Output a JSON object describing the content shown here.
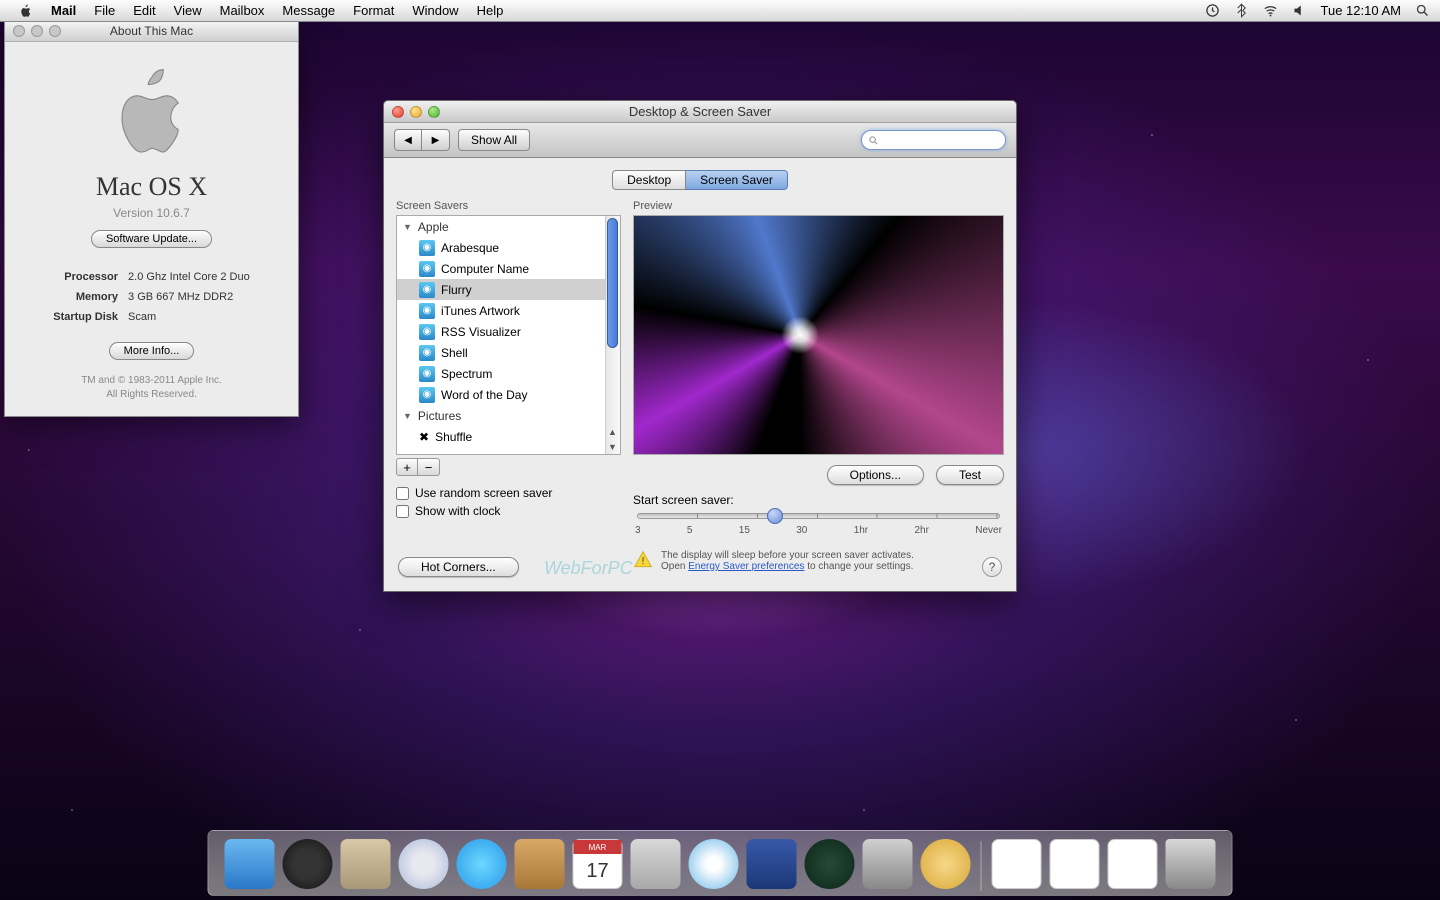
{
  "menubar": {
    "app": "Mail",
    "items": [
      "File",
      "Edit",
      "View",
      "Mailbox",
      "Message",
      "Format",
      "Window",
      "Help"
    ],
    "clock": "Tue 12:10 AM"
  },
  "about": {
    "title": "About This Mac",
    "os_name": "Mac OS X",
    "version": "Version 10.6.7",
    "software_update": "Software Update...",
    "specs": {
      "processor_label": "Processor",
      "processor_value": "2.0 Ghz Intel Core 2 Duo",
      "memory_label": "Memory",
      "memory_value": "3 GB 667 MHz DDR2",
      "disk_label": "Startup Disk",
      "disk_value": "Scam"
    },
    "more_info": "More Info...",
    "copyright1": "TM and © 1983-2011 Apple Inc.",
    "copyright2": "All Rights Reserved."
  },
  "prefs": {
    "title": "Desktop & Screen Saver",
    "show_all": "Show All",
    "tabs": {
      "desktop": "Desktop",
      "screensaver": "Screen Saver"
    },
    "left_label": "Screen Savers",
    "right_label": "Preview",
    "groups": {
      "apple": "Apple",
      "pictures": "Pictures"
    },
    "savers": [
      "Arabesque",
      "Computer Name",
      "Flurry",
      "iTunes Artwork",
      "RSS Visualizer",
      "Shell",
      "Spectrum",
      "Word of the Day"
    ],
    "shuffle": "Shuffle",
    "selected": "Flurry",
    "options_btn": "Options...",
    "test_btn": "Test",
    "random_cb": "Use random screen saver",
    "clock_cb": "Show with clock",
    "slider_label": "Start screen saver:",
    "ticks": [
      "3",
      "5",
      "15",
      "30",
      "1hr",
      "2hr",
      "Never"
    ],
    "warning_line1": "The display will sleep before your screen saver activates.",
    "warning_open": "Open ",
    "warning_link": "Energy Saver preferences",
    "warning_line2": " to change your settings.",
    "hot_corners": "Hot Corners...",
    "watermark": "WebForPC"
  },
  "dock": {
    "items": [
      "finder",
      "dashboard",
      "mail",
      "safari",
      "ichat",
      "addressbook",
      "ical",
      "preview",
      "itunes",
      "spaces",
      "timemachine",
      "sysprefs",
      "appstore"
    ],
    "right": [
      "pdf-doc1",
      "pdf-doc2",
      "pdf-doc3",
      "trash"
    ],
    "ical": {
      "month": "MAR",
      "day": "17"
    }
  },
  "colors": {
    "aqua_blue": "#4a7ad8",
    "selection": "#d0d0d0"
  }
}
